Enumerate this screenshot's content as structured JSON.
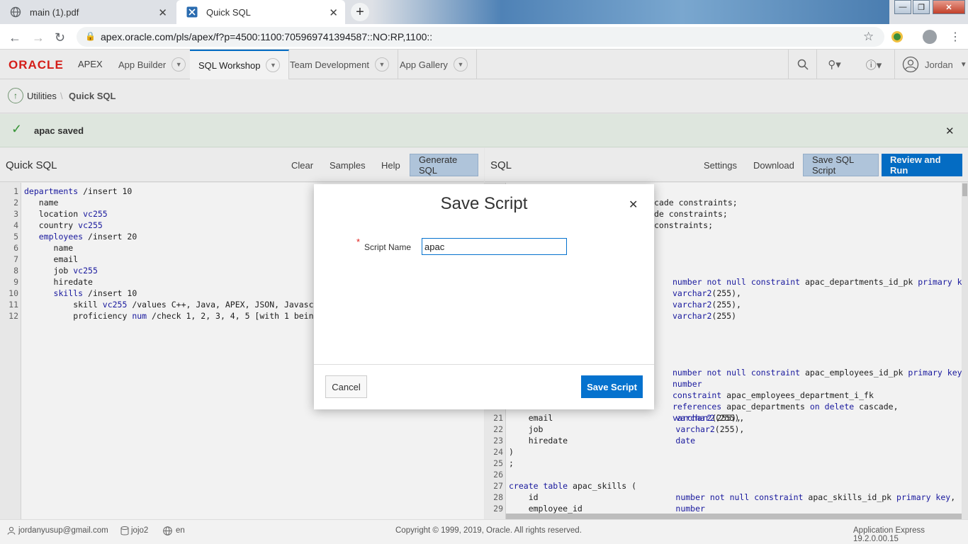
{
  "browser": {
    "tabs": [
      {
        "title": "main (1).pdf",
        "icon": "globe-icon"
      },
      {
        "title": "Quick SQL",
        "icon": "apex-icon"
      }
    ],
    "new_tab": "+",
    "url": "apex.oracle.com/pls/apex/f?p=4500:1100:705969741394587::NO:RP,1100::"
  },
  "apex": {
    "logo": "ORACLE",
    "logo_suffix": "APEX",
    "menus": [
      "App Builder",
      "SQL Workshop",
      "Team Development",
      "App Gallery"
    ],
    "active_menu": "SQL Workshop",
    "user": "Jordan"
  },
  "breadcrumb": {
    "parent": "Utilities",
    "current": "Quick SQL"
  },
  "message": {
    "text": "apac saved"
  },
  "left_pane": {
    "title": "Quick SQL",
    "buttons": [
      "Clear",
      "Samples",
      "Help",
      "Generate SQL"
    ],
    "lines": [
      {
        "n": "1",
        "text": "departments /insert 10"
      },
      {
        "n": "2",
        "text": "   name"
      },
      {
        "n": "3",
        "text": "   location vc255"
      },
      {
        "n": "4",
        "text": "   country vc255"
      },
      {
        "n": "5",
        "text": "   employees /insert 20"
      },
      {
        "n": "6",
        "text": "      name"
      },
      {
        "n": "7",
        "text": "      email"
      },
      {
        "n": "8",
        "text": "      job vc255"
      },
      {
        "n": "9",
        "text": "      hiredate"
      },
      {
        "n": "10",
        "text": "      skills /insert 10"
      },
      {
        "n": "11",
        "text": "          skill vc255 /values C++, Java, APEX, JSON, Javascrip"
      },
      {
        "n": "12",
        "text": "          proficiency num /check 1, 2, 3, 4, 5 [with 1 being a"
      }
    ]
  },
  "right_pane": {
    "title": "SQL",
    "buttons": [
      "Settings",
      "Download",
      "Save SQL Script",
      "Review and Run"
    ],
    "visible_fragments": [
      {
        "row": 1,
        "text": "cade constraints;"
      },
      {
        "row": 2,
        "text": "de constraints;"
      },
      {
        "row": 3,
        "text": "constraints;"
      }
    ],
    "type_column": [
      {
        "row": 8,
        "text": "number not null constraint apac_departments_id_pk primary key,"
      },
      {
        "row": 9,
        "text": "varchar2(255),"
      },
      {
        "row": 10,
        "text": "varchar2(255),"
      },
      {
        "row": 11,
        "text": "varchar2(255)"
      },
      {
        "row": 16,
        "text": "number not null constraint apac_employees_id_pk primary key,"
      },
      {
        "row": 17,
        "text": "number"
      },
      {
        "row": 18,
        "text": "constraint apac_employees_department_i_fk"
      },
      {
        "row": 19,
        "text": "references apac_departments on delete cascade,"
      },
      {
        "row": 20,
        "text": "varchar2(255),"
      }
    ],
    "lines": [
      {
        "n": "21",
        "text": "    email                         varchar2(255),"
      },
      {
        "n": "22",
        "text": "    job                           varchar2(255),"
      },
      {
        "n": "23",
        "text": "    hiredate                      date"
      },
      {
        "n": "24",
        "text": ")"
      },
      {
        "n": "25",
        "text": ";"
      },
      {
        "n": "26",
        "text": ""
      },
      {
        "n": "27",
        "text": "create table apac_skills ("
      },
      {
        "n": "28",
        "text": "    id                            number not null constraint apac_skills_id_pk primary key,"
      },
      {
        "n": "29",
        "text": "    employee_id                   number"
      }
    ]
  },
  "dialog": {
    "title": "Save Script",
    "field_label": "Script Name",
    "required_mark": "*",
    "field_value": "apac",
    "cancel": "Cancel",
    "save": "Save Script"
  },
  "footer": {
    "email": "jordanyusup@gmail.com",
    "workspace": "jojo2",
    "language": "en",
    "copyright": "Copyright © 1999, 2019, Oracle. All rights reserved.",
    "version": "Application Express 19.2.0.00.15"
  },
  "colors": {
    "accent": "#0572ce",
    "oracle_red": "#e0201b",
    "success": "#3a9c3a"
  }
}
